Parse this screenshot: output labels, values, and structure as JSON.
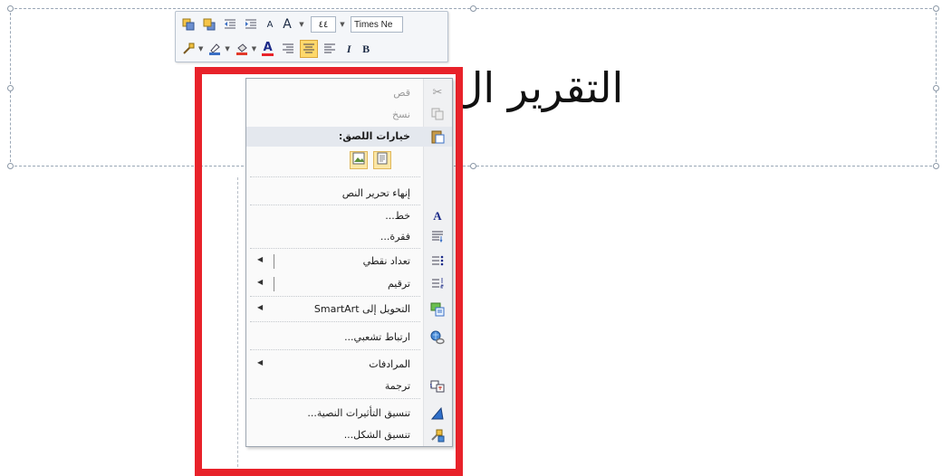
{
  "slide": {
    "title_text": "التقرير ال"
  },
  "mini_toolbar": {
    "font_name": "Times Ne",
    "font_size": "٤٤",
    "grow_font_label": "A",
    "shrink_font_label": "A",
    "bold_label": "B",
    "italic_label": "I",
    "font_color_label": "A"
  },
  "context_menu": {
    "items": [
      {
        "label": "قص",
        "icon": "scissors-icon",
        "disabled": true
      },
      {
        "label": "نسخ",
        "icon": "copy-icon",
        "disabled": true
      },
      {
        "label": "خيارات اللصق:",
        "icon": "paste-icon",
        "header": true
      },
      {
        "label": "إنهاء تحرير النص",
        "icon": ""
      },
      {
        "label": "خط...",
        "icon": "font-icon"
      },
      {
        "label": "فقرة...",
        "icon": "paragraph-icon"
      },
      {
        "label": "تعداد نقطي",
        "icon": "bullets-icon",
        "submenu": true
      },
      {
        "label": "ترقيم",
        "icon": "numbering-icon",
        "submenu": true
      },
      {
        "label": "التحويل إلى SmartArt",
        "icon": "smartart-icon",
        "submenu": true
      },
      {
        "label": "ارتباط تشعبي...",
        "icon": "hyperlink-icon"
      },
      {
        "label": "المرادفات",
        "icon": "",
        "submenu": true
      },
      {
        "label": "ترجمة",
        "icon": "translate-icon"
      },
      {
        "label": "تنسيق التأثيرات النصية...",
        "icon": "text-effects-icon"
      },
      {
        "label": "تنسيق الشكل...",
        "icon": "format-shape-icon"
      }
    ]
  },
  "colors": {
    "highlight_frame": "#e8222a",
    "active_button": "#ffd86b"
  }
}
